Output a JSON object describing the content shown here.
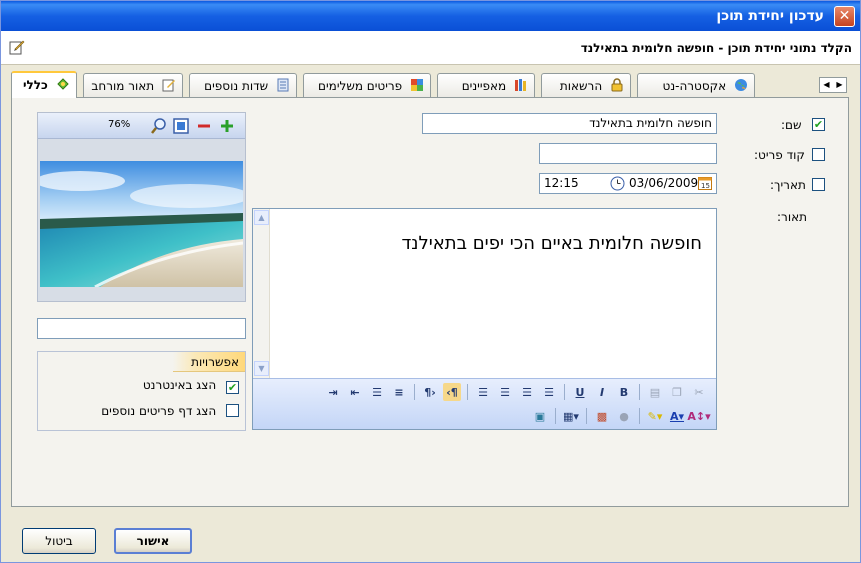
{
  "window": {
    "title": "עדכון יחידת תוכן",
    "close_glyph": "✕"
  },
  "header": {
    "breadcrumb": "הקלד נתוני יחידת תוכן - חופשה חלומית בתאילנד"
  },
  "tabs": [
    {
      "label": "כללי",
      "active": true,
      "icon": "general-icon"
    },
    {
      "label": "תאור מורחב",
      "icon": "edit-icon"
    },
    {
      "label": "שדות נוספים",
      "icon": "fields-icon"
    },
    {
      "label": "פריטים משלימים",
      "icon": "puzzle-icon"
    },
    {
      "label": "מאפיינים",
      "icon": "books-icon"
    },
    {
      "label": "הרשאות",
      "icon": "lock-icon"
    },
    {
      "label": "אקסטרה-נט",
      "icon": "globe-icon"
    }
  ],
  "form": {
    "name_label": "שם:",
    "name_checked": true,
    "name_value": "חופשה חלומית בתאילנד",
    "code_label": "קוד פריט:",
    "code_checked": false,
    "code_value": "",
    "date_label": "תאריך:",
    "date_checked": false,
    "date_value": "03/06/2009",
    "time_value": "12:15",
    "description_label": "תאור:",
    "description_text": "חופשה חלומית באיים הכי יפים בתאילנד"
  },
  "image_panel": {
    "zoom": "76%",
    "caption": ""
  },
  "options": {
    "title": "אפשרויות",
    "show_internet_label": "הצג באינטרנט",
    "show_internet_checked": true,
    "show_extra_page_label": "הצג דף פריטים נוספים",
    "show_extra_page_checked": false
  },
  "footer": {
    "ok_label": "אישור",
    "cancel_label": "ביטול"
  },
  "colors": {
    "titlebar": "#0a58e0",
    "accent_tab": "#ffc83c",
    "check_green": "#21a121"
  }
}
